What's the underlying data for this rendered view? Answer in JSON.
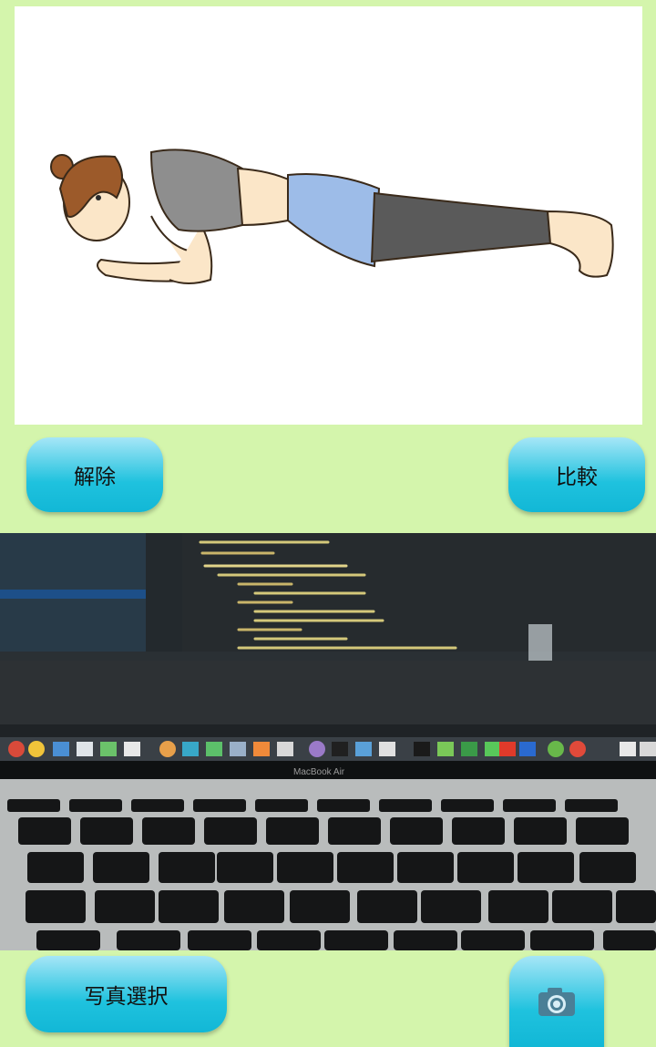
{
  "buttons": {
    "release_label": "解除",
    "compare_label": "比較",
    "select_photo_label": "写真選択",
    "camera_icon": "camera-icon"
  },
  "photo": {
    "laptop_brand": "MacBook Air"
  },
  "colors": {
    "background": "#d4f5ac",
    "button_top": "#a6e6f7",
    "button_bottom": "#12b7d6"
  }
}
